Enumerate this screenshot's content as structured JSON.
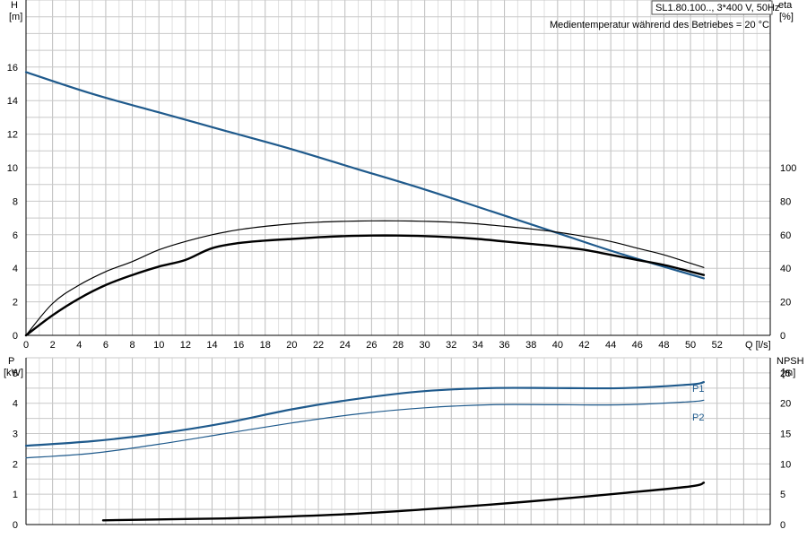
{
  "chart_data": [
    {
      "id": "top",
      "type": "line",
      "info_title": "SL1.80.100.., 3*400 V, 50Hz",
      "info_subtitle": "Medientemperatur während des Betriebes = 20 °C",
      "xlabel": "Q [l/s]",
      "xlim": [
        0,
        56
      ],
      "x_ticks": [
        0,
        2,
        4,
        6,
        8,
        10,
        12,
        14,
        16,
        18,
        20,
        22,
        24,
        26,
        28,
        30,
        32,
        34,
        36,
        38,
        40,
        42,
        44,
        46,
        48,
        50,
        52
      ],
      "left_axis": {
        "label_line1": "H",
        "label_line2": "[m]",
        "lim": [
          0,
          20
        ],
        "ticks": [
          0,
          2,
          4,
          6,
          8,
          10,
          12,
          14,
          16
        ]
      },
      "right_axis": {
        "label_line1": "eta",
        "label_line2": "[%]",
        "lim": [
          0,
          200
        ],
        "ticks": [
          0,
          20,
          40,
          60,
          80,
          100
        ]
      },
      "grid": true,
      "series": [
        {
          "axis": "left",
          "color": "#1f5a8c",
          "width": 2.2,
          "x": [
            0,
            5,
            10,
            15,
            20,
            25,
            30,
            35,
            40,
            45,
            51
          ],
          "y": [
            15.7,
            14.4,
            13.3,
            12.2,
            11.1,
            9.9,
            8.7,
            7.4,
            6.1,
            4.8,
            3.4
          ]
        },
        {
          "axis": "right",
          "color": "#000000",
          "width": 1.2,
          "x": [
            0,
            2,
            4,
            6,
            8,
            10,
            12,
            14,
            16,
            18,
            20,
            22,
            24,
            26,
            28,
            30,
            32,
            34,
            36,
            38,
            40,
            42,
            44,
            46,
            48,
            50,
            51
          ],
          "y": [
            0,
            19,
            30,
            38,
            44,
            51,
            56,
            60,
            63,
            65,
            66.5,
            67.5,
            68,
            68.3,
            68.3,
            68,
            67.5,
            66.5,
            65,
            63.5,
            61.5,
            59,
            56,
            52,
            48,
            43,
            40.5
          ]
        },
        {
          "axis": "right",
          "color": "#000000",
          "width": 2.4,
          "x": [
            0,
            2,
            4,
            6,
            8,
            10,
            12,
            14,
            16,
            18,
            20,
            22,
            24,
            26,
            28,
            30,
            32,
            34,
            36,
            38,
            40,
            42,
            44,
            46,
            48,
            50,
            51
          ],
          "y": [
            0,
            12,
            22,
            30,
            36,
            41,
            45,
            52,
            55,
            56.5,
            57.5,
            58.5,
            59.2,
            59.5,
            59.5,
            59.2,
            58.5,
            57.5,
            56,
            54.5,
            53,
            51,
            48,
            45,
            42,
            38,
            36
          ]
        }
      ]
    },
    {
      "id": "bottom",
      "type": "line",
      "xlim": [
        0,
        56
      ],
      "x_ticks": [],
      "left_axis": {
        "label_line1": "P",
        "label_line2": "[kW]",
        "lim": [
          0,
          5.5
        ],
        "ticks": [
          0,
          1,
          2,
          3,
          4,
          5
        ]
      },
      "right_axis": {
        "label_line1": "NPSH",
        "label_line2": "[m]",
        "lim": [
          0,
          27.5
        ],
        "ticks": [
          0,
          5,
          10,
          15,
          20,
          25
        ]
      },
      "grid": true,
      "series": [
        {
          "name": "P1",
          "axis": "left",
          "color": "#1f5a8c",
          "width": 2.2,
          "x": [
            0,
            5,
            10,
            15,
            20,
            25,
            30,
            35,
            40,
            45,
            50,
            51
          ],
          "y": [
            2.6,
            2.75,
            3.0,
            3.35,
            3.8,
            4.15,
            4.4,
            4.5,
            4.5,
            4.5,
            4.62,
            4.7
          ]
        },
        {
          "name": "P2",
          "axis": "left",
          "color": "#1f5a8c",
          "width": 1.2,
          "x": [
            0,
            5,
            10,
            15,
            20,
            25,
            30,
            35,
            40,
            45,
            50,
            51
          ],
          "y": [
            2.2,
            2.35,
            2.65,
            3.0,
            3.35,
            3.65,
            3.85,
            3.95,
            3.95,
            3.95,
            4.05,
            4.1
          ]
        },
        {
          "axis": "right",
          "color": "#000000",
          "width": 2.4,
          "x": [
            5.8,
            10,
            15,
            20,
            25,
            30,
            35,
            40,
            45,
            50,
            51
          ],
          "y": [
            0.7,
            0.85,
            1.0,
            1.35,
            1.8,
            2.5,
            3.3,
            4.2,
            5.2,
            6.3,
            6.9
          ]
        }
      ]
    }
  ]
}
